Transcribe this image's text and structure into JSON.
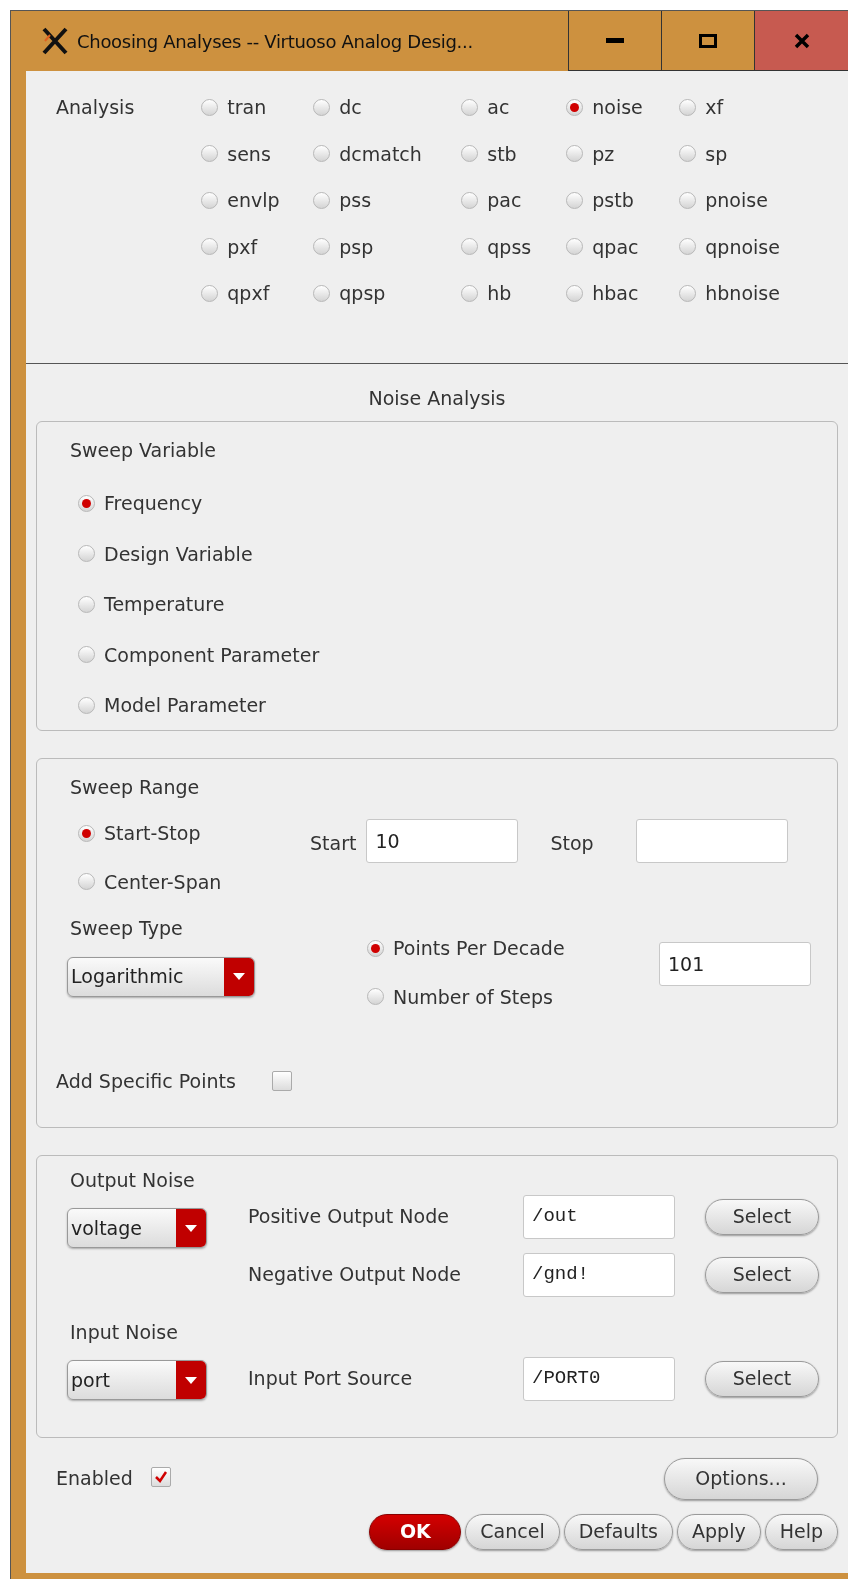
{
  "window": {
    "title": "Choosing Analyses -- Virtuoso Analog Desig...",
    "controls": [
      {
        "kind": "minimize"
      },
      {
        "kind": "maximize"
      },
      {
        "kind": "close"
      }
    ]
  },
  "analysis": {
    "label": "Analysis",
    "options": [
      {
        "label": "tran",
        "selected": false
      },
      {
        "label": "dc",
        "selected": false
      },
      {
        "label": "ac",
        "selected": false
      },
      {
        "label": "noise",
        "selected": true
      },
      {
        "label": "xf",
        "selected": false
      },
      {
        "label": "sens",
        "selected": false
      },
      {
        "label": "dcmatch",
        "selected": false
      },
      {
        "label": "stb",
        "selected": false
      },
      {
        "label": "pz",
        "selected": false
      },
      {
        "label": "sp",
        "selected": false
      },
      {
        "label": "envlp",
        "selected": false
      },
      {
        "label": "pss",
        "selected": false
      },
      {
        "label": "pac",
        "selected": false
      },
      {
        "label": "pstb",
        "selected": false
      },
      {
        "label": "pnoise",
        "selected": false
      },
      {
        "label": "pxf",
        "selected": false
      },
      {
        "label": "psp",
        "selected": false
      },
      {
        "label": "qpss",
        "selected": false
      },
      {
        "label": "qpac",
        "selected": false
      },
      {
        "label": "qpnoise",
        "selected": false
      },
      {
        "label": "qpxf",
        "selected": false
      },
      {
        "label": "qpsp",
        "selected": false
      },
      {
        "label": "hb",
        "selected": false
      },
      {
        "label": "hbac",
        "selected": false
      },
      {
        "label": "hbnoise",
        "selected": false
      }
    ]
  },
  "section_title": "Noise Analysis",
  "sweep_variable": {
    "label": "Sweep Variable",
    "options": [
      {
        "label": "Frequency",
        "selected": true
      },
      {
        "label": "Design Variable",
        "selected": false
      },
      {
        "label": "Temperature",
        "selected": false
      },
      {
        "label": "Component Parameter",
        "selected": false
      },
      {
        "label": "Model Parameter",
        "selected": false
      }
    ]
  },
  "sweep_range": {
    "label": "Sweep Range",
    "options": [
      {
        "label": "Start-Stop",
        "selected": true
      },
      {
        "label": "Center-Span",
        "selected": false
      }
    ],
    "start": {
      "label": "Start",
      "value": "10"
    },
    "stop": {
      "label": "Stop"
    },
    "sweep_type": {
      "label": "Sweep Type",
      "value": "Logarithmic"
    },
    "step_options": [
      {
        "label": "Points Per Decade",
        "selected": true
      },
      {
        "label": "Number of Steps",
        "selected": false
      }
    ],
    "step_value": "101",
    "add_specific_points": {
      "label": "Add Specific Points",
      "checked": false
    }
  },
  "output_noise": {
    "label": "Output Noise",
    "value": "voltage",
    "nodes": [
      {
        "label": "Positive Output Node",
        "value": "/out",
        "button": "Select"
      },
      {
        "label": "Negative Output Node",
        "value": "/gnd!",
        "button": "Select"
      }
    ]
  },
  "input_noise": {
    "label": "Input Noise",
    "value": "port",
    "source": {
      "label": "Input Port Source",
      "value": "/PORT0",
      "button": "Select"
    }
  },
  "enabled": {
    "label": "Enabled",
    "checked": true
  },
  "options_button": "Options...",
  "buttons": [
    {
      "label": "OK",
      "primary": true
    },
    {
      "label": "Cancel",
      "primary": false
    },
    {
      "label": "Defaults",
      "primary": false
    },
    {
      "label": "Apply",
      "primary": false
    },
    {
      "label": "Help",
      "primary": false
    }
  ]
}
